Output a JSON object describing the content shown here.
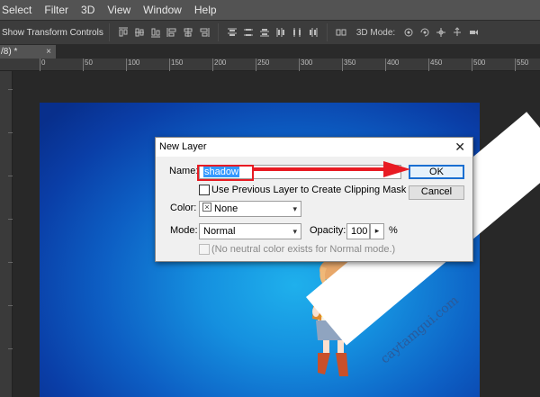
{
  "menu": {
    "items": [
      "Select",
      "Filter",
      "3D",
      "View",
      "Window",
      "Help"
    ]
  },
  "options_bar": {
    "show_transform_controls": "Show Transform Controls",
    "mode_3d_label": "3D Mode:"
  },
  "document_tab": {
    "title": "/8) *",
    "close": "×"
  },
  "ruler": {
    "labels": [
      "0",
      "50",
      "100",
      "150",
      "200",
      "250",
      "300",
      "350",
      "400",
      "450",
      "500",
      "550"
    ]
  },
  "dialog": {
    "title": "New Layer",
    "close": "✕",
    "name_label": "Name:",
    "name_value": "shadow",
    "use_previous_label": "Use Previous Layer to Create Clipping Mask",
    "color_label": "Color:",
    "color_value": "None",
    "mode_label": "Mode:",
    "mode_value": "Normal",
    "opacity_label": "Opacity:",
    "opacity_value": "100",
    "opacity_unit": "%",
    "neutral_label": "(No neutral color exists for Normal mode.)",
    "ok_label": "OK",
    "cancel_label": "Cancel"
  },
  "watermark": {
    "text": "caytamgui.com"
  },
  "colors": {
    "annotation_red": "#e81b23",
    "selection_blue": "#3399ff",
    "canvas_blue": "#1590df"
  }
}
